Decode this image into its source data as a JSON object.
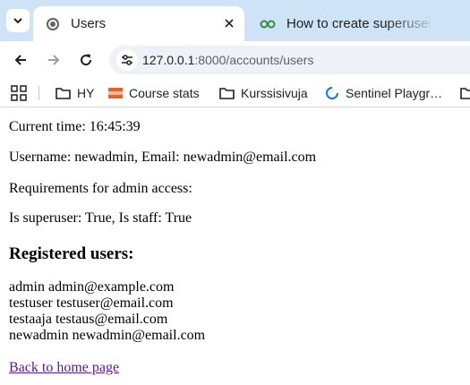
{
  "browser": {
    "tabs": [
      {
        "title": "Users",
        "active": true
      },
      {
        "title": "How to create superuser",
        "active": false
      }
    ],
    "url_host": "127.0.0.1",
    "url_rest": ":8000/accounts/users",
    "bookmarks": [
      {
        "label": "HY",
        "icon": "folder-icon"
      },
      {
        "label": "Course stats",
        "icon": "flag-icon"
      },
      {
        "label": "Kurssisivuja",
        "icon": "folder-icon"
      },
      {
        "label": "Sentinel Playgr…",
        "icon": "loading-icon"
      }
    ],
    "colors": {
      "tab_strip": "#cfe3f7",
      "link_visited": "#551a8b"
    }
  },
  "page": {
    "current_time": "Current time: 16:45:39",
    "user_info": "Username: newadmin, Email: newadmin@email.com",
    "requirements": "Requirements for admin access:",
    "flags": "Is superuser: True, Is staff: True",
    "registered_heading": "Registered users:",
    "users": [
      "admin admin@example.com",
      "testuser testuser@email.com",
      "testaaja testaus@email.com",
      "newadmin newadmin@email.com"
    ],
    "back_link": "Back to home page"
  }
}
